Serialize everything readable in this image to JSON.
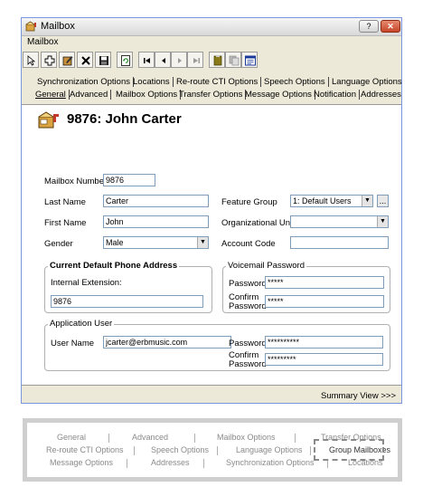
{
  "window": {
    "title": "Mailbox",
    "help_label": "?",
    "close_label": "✕",
    "app_icon": "mailbox-app-icon"
  },
  "menu": {
    "items": [
      "Mailbox"
    ]
  },
  "toolbar": {
    "icons": [
      "pointer-icon",
      "add-icon",
      "edit-icon",
      "delete-icon",
      "save-icon",
      "refresh-icon",
      "first-record-icon",
      "prev-record-icon",
      "next-record-icon",
      "last-record-icon",
      "report-icon",
      "copy-icon",
      "view-icon"
    ]
  },
  "tabs": {
    "row1": [
      "Synchronization Options",
      "Locations",
      "Re-route CTI Options",
      "Speech Options",
      "Language Options"
    ],
    "row2": [
      "General",
      "Advanced",
      "Mailbox Options",
      "Transfer Options",
      "Message Options",
      "Notification",
      "Addresses"
    ]
  },
  "header": {
    "title": "9876: John Carter"
  },
  "form": {
    "mailbox_number": {
      "label": "Mailbox Number",
      "value": "9876"
    },
    "last_name": {
      "label": "Last Name",
      "value": "Carter"
    },
    "first_name": {
      "label": "First Name",
      "value": "John"
    },
    "gender": {
      "label": "Gender",
      "value": "Male"
    },
    "feature_group": {
      "label": "Feature Group",
      "value": "1: Default Users",
      "more_label": "..."
    },
    "org_unit": {
      "label": "Organizational Unit",
      "value": ""
    },
    "account_code": {
      "label": "Account Code",
      "value": ""
    }
  },
  "phone_group": {
    "title": "Current Default Phone Address",
    "ext_label": "Internal Extension:",
    "ext_value": "9876"
  },
  "voicemail_group": {
    "title": "Voicemail Password",
    "password_label": "Password",
    "password_value": "*****",
    "confirm_label_1": "Confirm",
    "confirm_label_2": "Password",
    "confirm_value": "*****"
  },
  "app_user_group": {
    "title": "Application User",
    "user_label": "User Name",
    "user_value": "jcarter@erbmusic.com",
    "password_label": "Password",
    "password_value": "**********",
    "confirm_label_1": "Confirm",
    "confirm_label_2": "Password",
    "confirm_value": "*********"
  },
  "status": {
    "summary_link": "Summary View >>>"
  },
  "legacy_tabs": {
    "row1": [
      "General",
      "Advanced",
      "Mailbox Options",
      "Transfer Options"
    ],
    "row2": [
      "Re-route CTI Options",
      "Speech Options",
      "Language Options",
      "Group Mailboxes"
    ],
    "row3": [
      "Message Options",
      "Addresses",
      "Synchronization Options",
      "Locations"
    ]
  }
}
